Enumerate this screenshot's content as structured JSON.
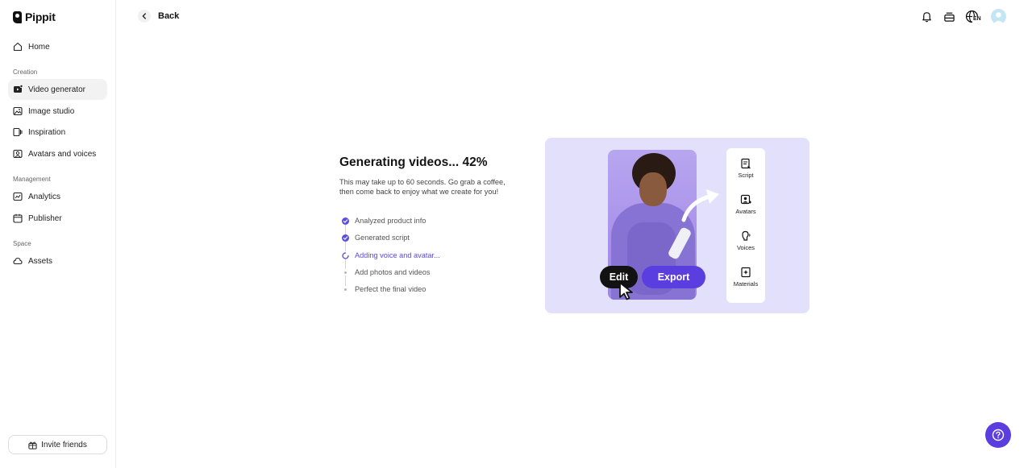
{
  "app": {
    "name": "Pippit"
  },
  "sidebar": {
    "home": "Home",
    "sections": {
      "creation": "Creation",
      "management": "Management",
      "space": "Space"
    },
    "items": {
      "video_generator": "Video generator",
      "image_studio": "Image studio",
      "inspiration": "Inspiration",
      "avatars_voices": "Avatars and voices",
      "analytics": "Analytics",
      "publisher": "Publisher",
      "assets": "Assets"
    },
    "active_item": "Video generator",
    "invite_label": "Invite friends"
  },
  "topbar": {
    "back_label": "Back",
    "language_code": "EN"
  },
  "generation": {
    "title": "Generating videos... 42%",
    "progress_percent": 42,
    "description_line1": "This may take up to 60 seconds. Go grab a coffee,",
    "description_line2": "then come back to enjoy what we create for you!",
    "steps": [
      {
        "label": "Analyzed product info",
        "status": "done"
      },
      {
        "label": "Generated script",
        "status": "done"
      },
      {
        "label": "Adding voice and avatar...",
        "status": "in-progress"
      },
      {
        "label": "Add photos and videos",
        "status": "pending"
      },
      {
        "label": "Perfect the final video",
        "status": "pending"
      }
    ]
  },
  "preview": {
    "side_items": [
      "Script",
      "Avatars",
      "Voices",
      "Materials"
    ],
    "edit_label": "Edit",
    "export_label": "Export"
  },
  "colors": {
    "accent": "#5b3ee0",
    "accent_text": "#5b47e8",
    "preview_bg": "#e3e0fb"
  }
}
